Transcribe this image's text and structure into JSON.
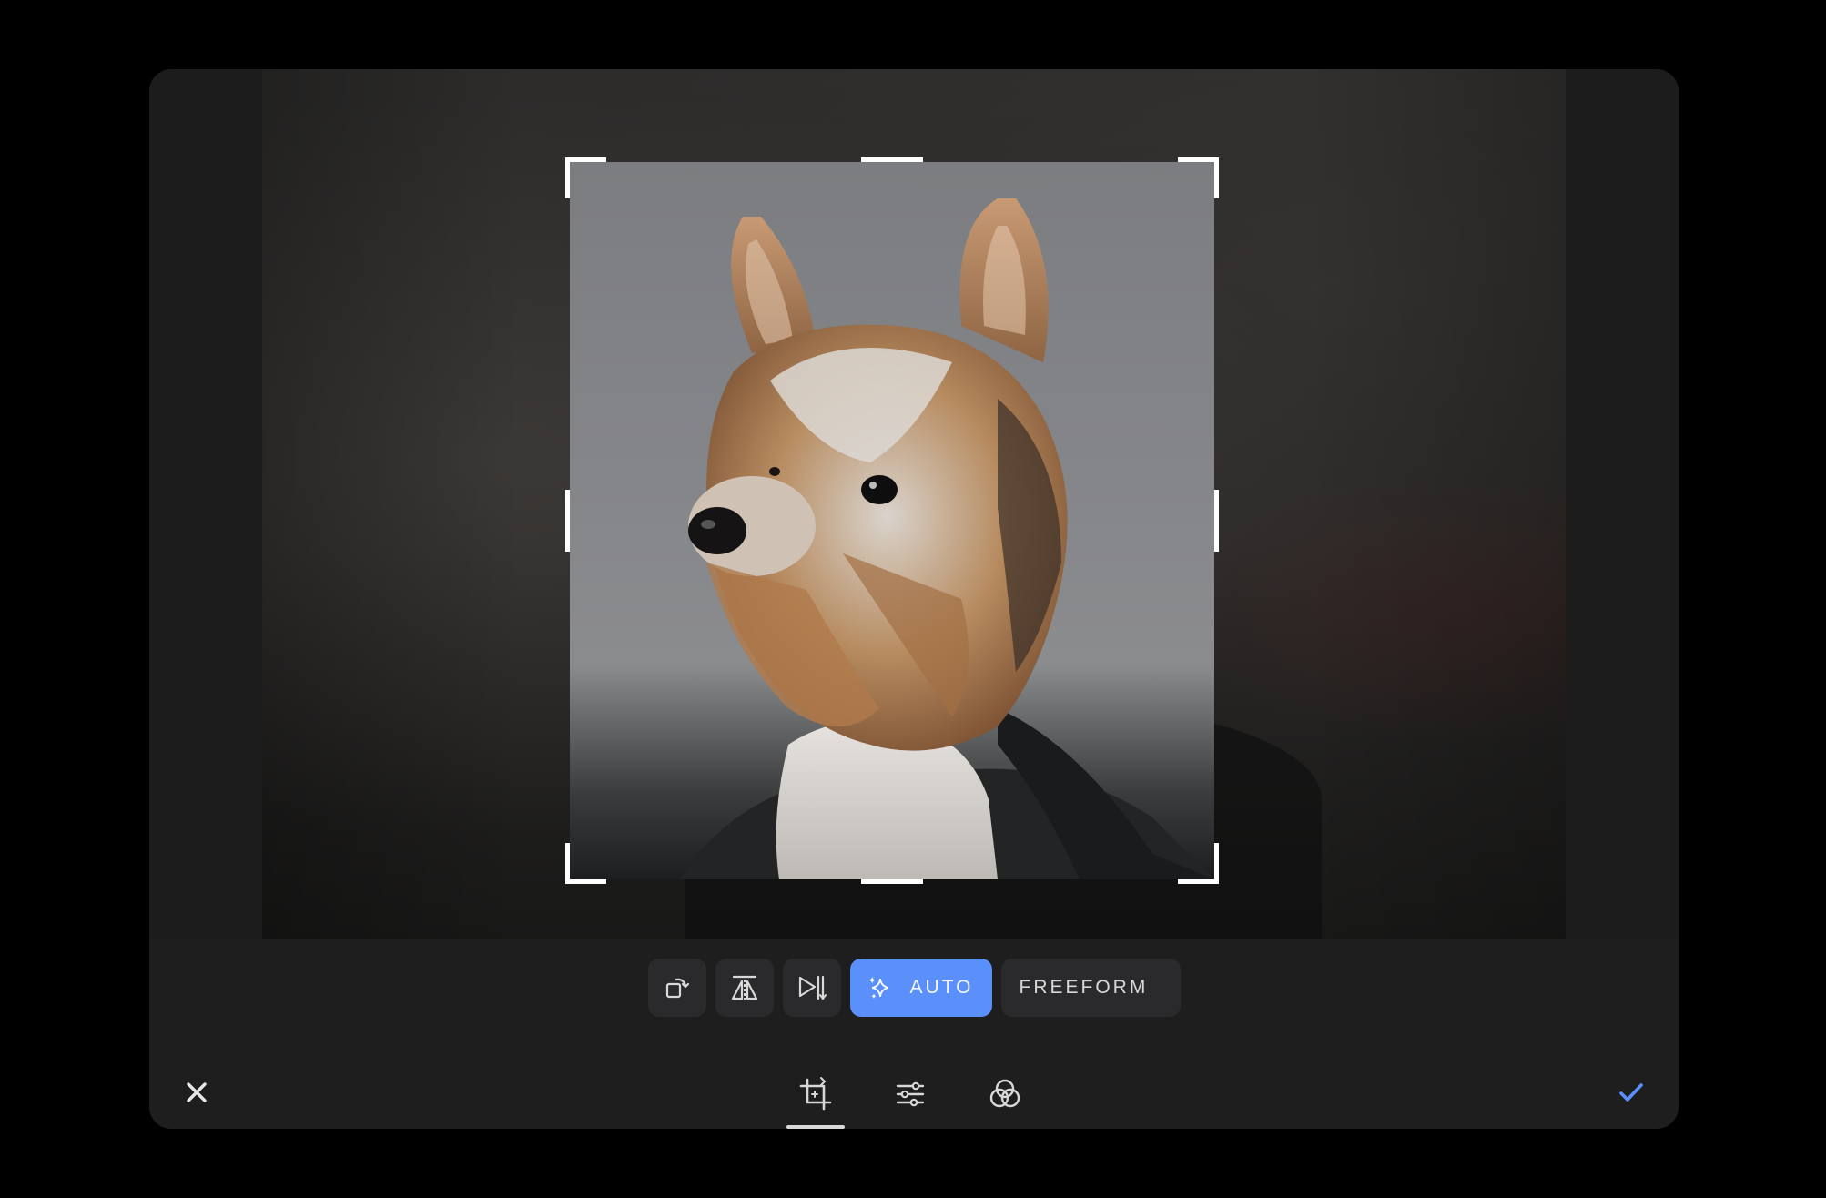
{
  "editor": {
    "mode": "crop",
    "toolbar": {
      "rotate_icon": "rotate-icon",
      "flip_horizontal_icon": "flip-horizontal-icon",
      "flip_vertical_icon": "flip-vertical-icon",
      "auto_label": "AUTO",
      "auto_icon": "sparkle-icon",
      "aspect_label": "FREEFORM",
      "aspect_icon": "chevron-down-icon",
      "auto_color": "#5b8ff9"
    },
    "bottom": {
      "cancel_icon": "close-icon",
      "confirm_icon": "check-icon",
      "confirm_color": "#5b8ff9",
      "tabs": [
        {
          "icon": "crop-icon",
          "active": true
        },
        {
          "icon": "adjust-sliders-icon",
          "active": false
        },
        {
          "icon": "filters-icon",
          "active": false
        }
      ]
    },
    "image": {
      "subject": "yorkshire-terrier-photo"
    }
  }
}
